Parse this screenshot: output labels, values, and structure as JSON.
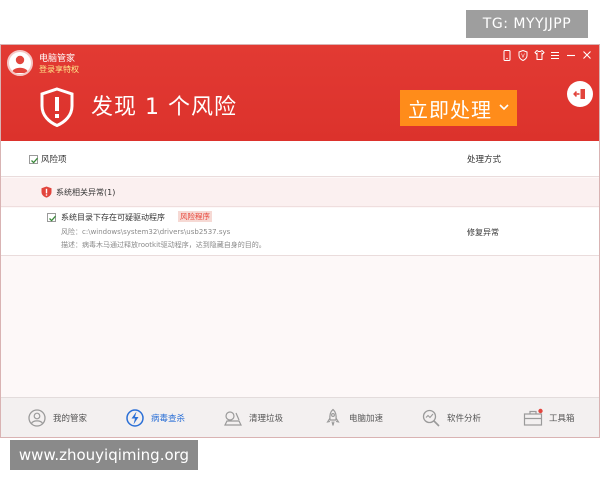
{
  "watermarks": {
    "tg": "TG: MYYJJPP",
    "site": "www.zhouyiqiming.org"
  },
  "app": {
    "name": "电脑管家",
    "login_link": "登录享特权"
  },
  "header": {
    "headline": "发现 1 个风险",
    "fix_button": "立即处理"
  },
  "list": {
    "col_risk": "风险项",
    "col_action": "处理方式",
    "group": {
      "label": "系统相关异常(1)"
    },
    "items": [
      {
        "title": "系统目录下存在可疑驱动程序",
        "tag": "风险程序",
        "path": "风险：c:\\windows\\system32\\drivers\\usb2537.sys",
        "desc": "描述：病毒木马通过释放rootkit驱动程序，达到隐藏自身的目的。",
        "action": "修复异常"
      }
    ]
  },
  "toolbar": {
    "items": [
      {
        "label": "我的管家",
        "icon": "my-manager-icon"
      },
      {
        "label": "病毒查杀",
        "icon": "virus-scan-icon"
      },
      {
        "label": "清理垃圾",
        "icon": "cleanup-icon"
      },
      {
        "label": "电脑加速",
        "icon": "rocket-icon"
      },
      {
        "label": "软件分析",
        "icon": "software-analysis-icon"
      },
      {
        "label": "工具箱",
        "icon": "toolbox-icon"
      }
    ],
    "active_index": 1
  },
  "colors": {
    "header_red": "#dc322c",
    "fix_orange": "#ff8c1a",
    "active_blue": "#2a6fd6",
    "risk_tag_red": "#e8453a"
  }
}
